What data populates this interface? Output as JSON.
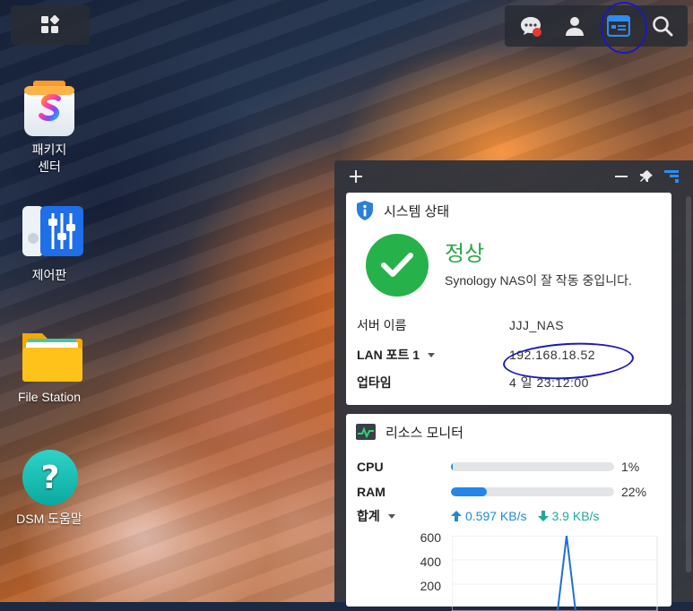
{
  "desktop": {
    "icons": [
      {
        "label": "패키지\n센터"
      },
      {
        "label": "제어판"
      },
      {
        "label": "File Station"
      },
      {
        "label": "DSM 도움말"
      }
    ]
  },
  "taskbar": {
    "right_buttons": [
      {
        "icon": "chat-icon",
        "badge": true
      },
      {
        "icon": "user-icon"
      },
      {
        "icon": "widget-icon",
        "active": true
      },
      {
        "icon": "search-icon"
      }
    ]
  },
  "widget_panel": {
    "system_status": {
      "title": "시스템 상태",
      "status": "정상",
      "message": "Synology NAS이 잘 작동 중입니다.",
      "rows": [
        {
          "key": "서버 이름",
          "value": "JJJ_NAS"
        },
        {
          "key": "LAN 포트 1",
          "value": "192.168.18.52"
        },
        {
          "key": "업타임",
          "value": "4 일 23:12:00"
        }
      ]
    },
    "resource_monitor": {
      "title": "리소스 모니터",
      "cpu": {
        "label": "CPU",
        "percent": 1,
        "percent_text": "1%"
      },
      "ram": {
        "label": "RAM",
        "percent": 22,
        "percent_text": "22%"
      },
      "total": {
        "label": "합계",
        "upload": "0.597 KB/s",
        "download": "3.9 KB/s"
      },
      "chart_yticks": [
        "600",
        "400",
        "200"
      ]
    }
  },
  "colors": {
    "accent": "#2f8cf0",
    "ok_green": "#27b14a",
    "bar_blue": "#2387e8",
    "annotation": "#1a1ab8"
  }
}
